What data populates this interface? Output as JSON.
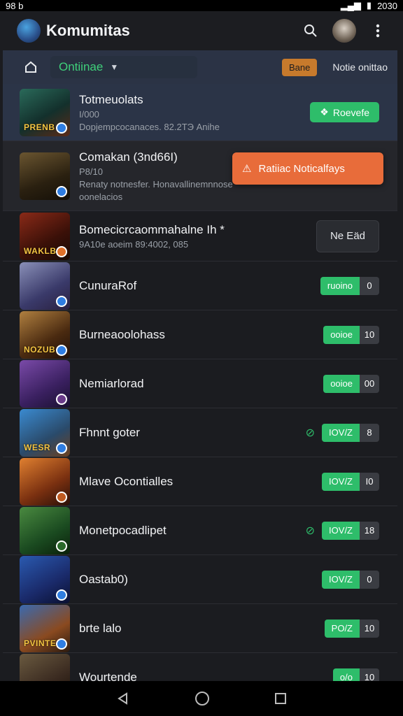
{
  "status": {
    "left": "98 b",
    "time": "2030"
  },
  "app": {
    "title": "Komumitas"
  },
  "filter": {
    "dropdown": "Ontiinae",
    "chip": "Bane",
    "notif_link": "Notie onittao"
  },
  "toast": {
    "label": "Ratiiac Noticalfays"
  },
  "rows": [
    {
      "title": "Totmeuolats",
      "line1": "I/000",
      "line2": "Dopjempcocanaces. 82.2ТЭ Anihe",
      "thumb_label": "PRENB",
      "action": "Roevefe"
    },
    {
      "title": "Comakan (3nd66I)",
      "line1": "P8/10",
      "line2": "Renaty notnesfer. Honavallinemnnose",
      "line3": "oonelacios"
    },
    {
      "title": "Bomecicrcaommahalne Ih *",
      "line1": "9A10e aoeim 89:4002, 085",
      "thumb_label": "WAKLB",
      "action": "Ne Eäd"
    },
    {
      "title": "CunuraRof",
      "pill": "ruoino",
      "count": "0"
    },
    {
      "title": "Burneaoolohass",
      "thumb_label": "NOZUB",
      "pill": "ooioe",
      "count": "10"
    },
    {
      "title": "Nemiarlorad",
      "pill": "ooioe",
      "count": "00"
    },
    {
      "title": "Fhnnt goter",
      "thumb_label": "WESR",
      "pill": "IOV/Z",
      "count": "8"
    },
    {
      "title": "Mlave Ocontialles",
      "pill": "IOV/Z",
      "count": "I0"
    },
    {
      "title": "Monetpocadlipet",
      "pill": "IOV/Z",
      "count": "18"
    },
    {
      "title": "Oastab0)",
      "pill": "IOV/Z",
      "count": "0"
    },
    {
      "title": "brte lalo",
      "thumb_label": "PVINTE",
      "pill": "PO/Z",
      "count": "10"
    },
    {
      "title": "Wourtende",
      "pill": "o/o",
      "count": "10"
    }
  ]
}
